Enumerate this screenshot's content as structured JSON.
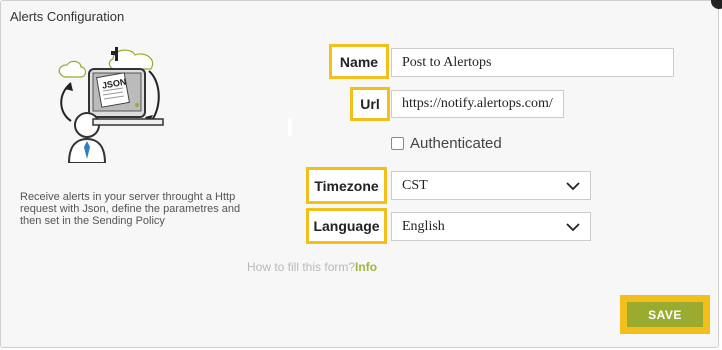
{
  "dialog": {
    "title": "Alerts Configuration",
    "description": "Receive alerts in your server throught a Http request with Json, define the parametres and then set in the Sending Policy",
    "illustration_label": "JSON"
  },
  "form": {
    "name_label": "Name",
    "name_value": "Post to  Alertops",
    "url_label": "Url",
    "url_value": "https://notify.alertops.com/",
    "authenticated_label": "Authenticated",
    "timezone_label": "Timezone",
    "timezone_value": "CST",
    "language_label": "Language",
    "language_value": "English"
  },
  "help": {
    "text": "How to fill this form?",
    "link": "Info"
  },
  "actions": {
    "save_label": "SAVE"
  },
  "colors": {
    "highlight": "#f3c01b",
    "save_button": "#9bab2f",
    "link": "#9fb83a"
  }
}
